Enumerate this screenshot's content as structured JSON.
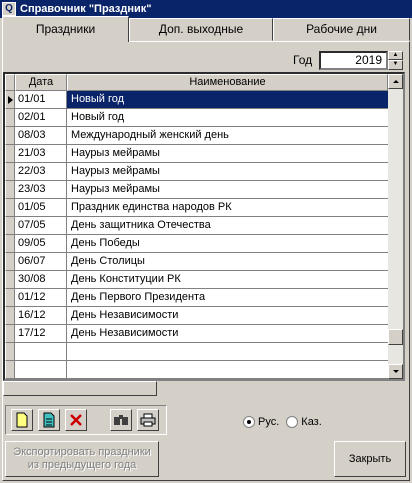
{
  "window": {
    "title": "Справочник \"Праздник\"",
    "icon": "app-icon"
  },
  "tabs": [
    {
      "label": "Праздники",
      "active": true
    },
    {
      "label": "Доп. выходные",
      "active": false
    },
    {
      "label": "Рабочие дни",
      "active": false
    }
  ],
  "year": {
    "label": "Год",
    "value": "2019"
  },
  "table": {
    "columns": [
      "Дата",
      "Наименование"
    ],
    "rows": [
      {
        "date": "01/01",
        "name": "Новый год",
        "selected": true
      },
      {
        "date": "02/01",
        "name": "Новый год"
      },
      {
        "date": "08/03",
        "name": "Международный женский день"
      },
      {
        "date": "21/03",
        "name": "Наурыз мейрамы"
      },
      {
        "date": "22/03",
        "name": "Наурыз мейрамы"
      },
      {
        "date": "23/03",
        "name": "Наурыз мейрамы"
      },
      {
        "date": "01/05",
        "name": "Праздник единства народов РК"
      },
      {
        "date": "07/05",
        "name": "День защитника Отечества"
      },
      {
        "date": "09/05",
        "name": "День Победы"
      },
      {
        "date": "06/07",
        "name": "День Столицы"
      },
      {
        "date": "30/08",
        "name": "День Конституции РК"
      },
      {
        "date": "01/12",
        "name": "День Первого Президента"
      },
      {
        "date": "16/12",
        "name": "День Независимости"
      },
      {
        "date": "17/12",
        "name": "День Независимости"
      },
      {
        "date": "",
        "name": ""
      },
      {
        "date": "",
        "name": ""
      }
    ]
  },
  "toolbar": [
    "new-icon",
    "edit-icon",
    "delete-icon",
    "find-icon",
    "print-icon"
  ],
  "language": {
    "options": [
      "Рус.",
      "Каз."
    ],
    "selected": "Рус."
  },
  "buttons": {
    "export_line1": "Экспортировать праздники",
    "export_line2": "из предыдущего года",
    "close": "Закрыть"
  },
  "colors": {
    "titlebar": "#0a246a",
    "selection": "#0a246a",
    "delete": "#cc0000"
  }
}
